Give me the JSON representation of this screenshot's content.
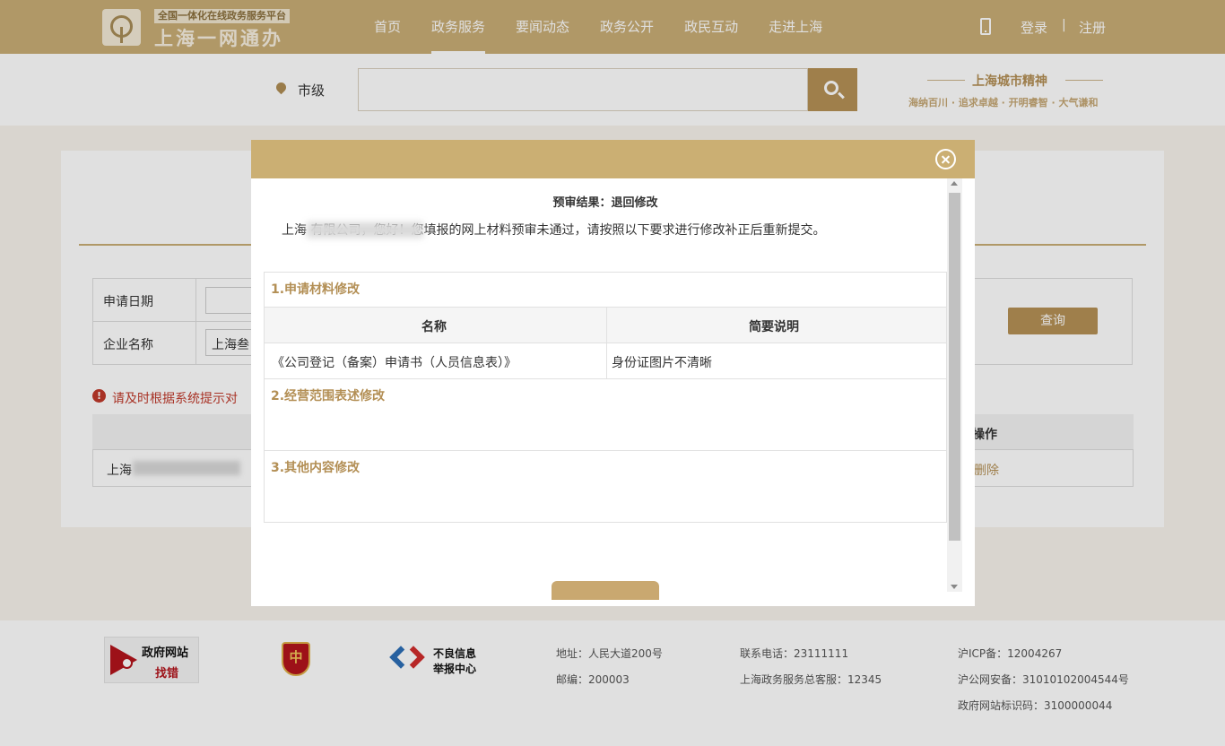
{
  "header": {
    "platform_tag": "全国一体化在线政务服务平台",
    "site_title": "上海一网通办",
    "nav": [
      {
        "label": "首页"
      },
      {
        "label": "政务服务"
      },
      {
        "label": "要闻动态"
      },
      {
        "label": "政务公开"
      },
      {
        "label": "政民互动"
      },
      {
        "label": "走进上海"
      }
    ],
    "active_nav": "政务服务",
    "login": "登录",
    "separator": "|",
    "register": "注册"
  },
  "search": {
    "city": "市级",
    "placeholder": ""
  },
  "spirit": {
    "title": "上海城市精神",
    "subtitle": "海纳百川 · 追求卓越 · 开明睿智 · 大气谦和"
  },
  "page": {
    "apply_date_label": "申请日期",
    "company_label": "企业名称",
    "company_value": "上海叁",
    "query_button": "查询",
    "warning": "请及时根据系统提示对",
    "list_header_op": "操作",
    "list_row_name": "上海",
    "list_row_op": "删除"
  },
  "modal": {
    "result_title": "预审结果：退回修改",
    "greeting": "上海                        有限公司，您好！您填报的网上材料预审未通过，请按照以下要求进行修改补正后重新提交。",
    "sections": [
      {
        "title": "1.申请材料修改"
      },
      {
        "title": "2.经营范围表述修改"
      },
      {
        "title": "3.其他内容修改"
      }
    ],
    "table": {
      "headers": [
        "名称",
        "简要说明"
      ],
      "rows": [
        [
          "《公司登记（备案）申请书（人员信息表）》",
          "身份证图片不清晰"
        ]
      ]
    }
  },
  "footer": {
    "badge_line1": "政府网站",
    "badge_line2": "找错",
    "shield_text": "中",
    "report_line1": "不良信息",
    "report_line2": "举报中心",
    "address": "地址：人民大道200号",
    "postcode": "邮编：200003",
    "phone": "联系电话：23111111",
    "hotline": "上海政务服务总客服：12345",
    "icp": "沪ICP备：12004267",
    "police": "沪公网安备：31010102004544号",
    "site_id": "政府网站标识码：3100000044"
  },
  "colors": {
    "brand_gold": "#c9ad76",
    "accent_brown": "#b38f55",
    "warning_red": "#c0392b"
  }
}
